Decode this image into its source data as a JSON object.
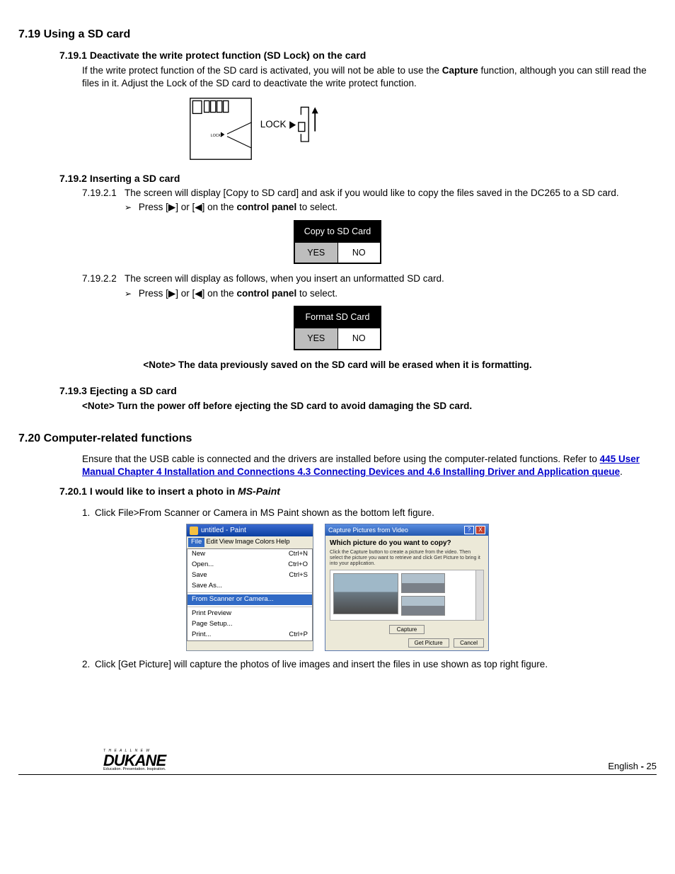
{
  "s719": {
    "heading": "7.19 Using a SD card",
    "s1": {
      "heading": "7.19.1  Deactivate the write protect function (SD Lock) on the card",
      "body_pre": "If the write protect function of the SD card is activated, you will not be able to use the ",
      "bold": "Capture",
      "body_post": " function, although you can still read the files in it. Adjust the Lock of the SD card to deactivate the write protect function.",
      "lock_small": "LOCK",
      "lock_big": "LOCK"
    },
    "s2": {
      "heading": "7.19.2  Inserting a SD card",
      "p1_num": "7.19.2.1",
      "p1_text": "The screen will display [Copy to SD card] and ask if you would like to copy the files saved in the DC265 to a SD card.",
      "bullet_pre": "Press [",
      "bullet_mid": "] or [",
      "bullet_post": "] on the ",
      "bullet_bold": "control panel",
      "bullet_end": " to select.",
      "dlg1_title": "Copy to SD Card",
      "dlg1_yes": "YES",
      "dlg1_no": "NO",
      "p2_num": "7.19.2.2",
      "p2_text": "The screen will display as follows, when you insert an unformatted SD card.",
      "dlg2_title": "Format SD Card",
      "dlg2_yes": "YES",
      "dlg2_no": "NO",
      "note": "<Note> The data previously saved on the SD card will be erased when it is formatting."
    },
    "s3": {
      "heading": "7.19.3  Ejecting a SD card",
      "note": "<Note> Turn the power off before ejecting the SD card to avoid damaging the SD card."
    }
  },
  "s720": {
    "heading": "7.20 Computer-related functions",
    "intro": "Ensure that the USB cable is connected and the drivers are installed before using the computer-related functions. Refer to ",
    "link": "445 User Manual Chapter 4 Installation and Connections 4.3 Connecting Devices and 4.6 Installing Driver and Application queue",
    "period": ".",
    "s1": {
      "heading_pre": "7.20.1 I would like to insert a photo in ",
      "heading_it": "MS-Paint",
      "li1_num": "1.",
      "li1_text": "Click File>From Scanner or Camera in MS Paint shown as the bottom left figure.",
      "li2_num": "2.",
      "li2_text": "Click [Get Picture] will capture the photos of live images and insert the files in use shown as top right figure."
    }
  },
  "paint": {
    "title": "untitled - Paint",
    "menu": {
      "file": "File",
      "edit": "Edit",
      "view": "View",
      "image": "Image",
      "colors": "Colors",
      "help": "Help"
    },
    "drop": {
      "new": "New",
      "new_k": "Ctrl+N",
      "open": "Open...",
      "open_k": "Ctrl+O",
      "save": "Save",
      "save_k": "Ctrl+S",
      "saveas": "Save As...",
      "scanner": "From Scanner or Camera...",
      "preview": "Print Preview",
      "setup": "Page Setup...",
      "print": "Print...",
      "print_k": "Ctrl+P"
    }
  },
  "capwin": {
    "title": "Capture Pictures from Video",
    "question": "Which picture do you want to copy?",
    "sub": "Click the Capture button to create a picture from the video. Then select the picture you want to retrieve and click Get Picture to bring it into your application.",
    "capture_btn": "Capture",
    "get_btn": "Get Picture",
    "cancel_btn": "Cancel",
    "help_icon": "?",
    "close_icon": "X"
  },
  "footer": {
    "tagline": "T H E   A L L   N E W",
    "brand": "DUKANE",
    "sub": "Education. Presentation. Inspiration.",
    "page_pre": "English ",
    "page_dash": "-",
    "page_num": " 25"
  }
}
